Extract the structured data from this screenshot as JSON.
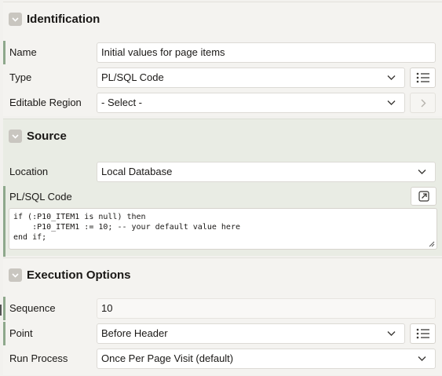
{
  "identification": {
    "title": "Identification",
    "name_label": "Name",
    "name_value": "Initial values for page items",
    "type_label": "Type",
    "type_value": "PL/SQL Code",
    "editable_region_label": "Editable Region",
    "editable_region_value": "- Select -"
  },
  "source": {
    "title": "Source",
    "location_label": "Location",
    "location_value": "Local Database",
    "code_label": "PL/SQL Code",
    "code_lines": [
      "if (:P10_ITEM1 is null) then",
      "    :P10_ITEM1 := 10; -- your default value here",
      "end if;"
    ]
  },
  "execution": {
    "title": "Execution Options",
    "sequence_label": "Sequence",
    "sequence_value": "10",
    "point_label": "Point",
    "point_value": "Before Header",
    "run_process_label": "Run Process",
    "run_process_value": "Once Per Page Visit (default)"
  },
  "colors": {
    "active_indicator": "#8ea88c",
    "source_background": "#e9ece4",
    "section_background": "#f4f3f0"
  },
  "icons": {
    "collapse": "chevron-down-icon",
    "list_picker": "list-icon",
    "go_to": "chevron-right-icon",
    "expand_editor": "open-external-icon"
  }
}
